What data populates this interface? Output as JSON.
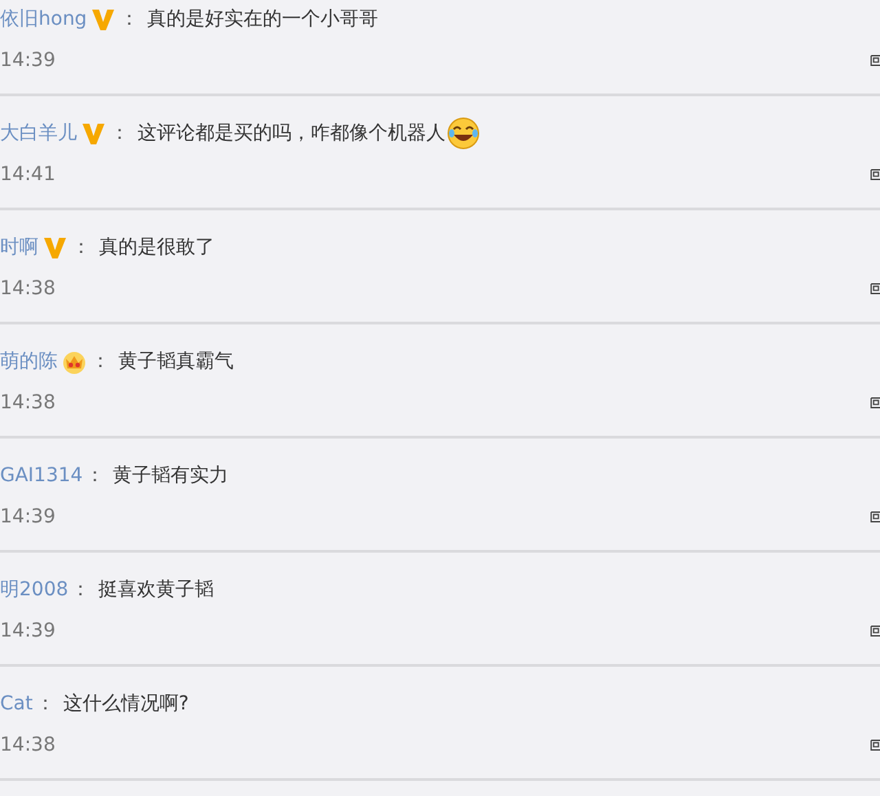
{
  "comments": [
    {
      "user": "依旧hong",
      "badge": {
        "kind": "vip"
      },
      "separator": "：",
      "text": "真的是好实在的一个小哥哥",
      "time": "14:39"
    },
    {
      "user": "大白羊儿",
      "badge": {
        "kind": "vip"
      },
      "separator": "：",
      "text": "这评论都是买的吗，咋都像个机器人",
      "emoji": {
        "kind": "laugh"
      },
      "time": "14:41"
    },
    {
      "user": "时啊",
      "badge": {
        "kind": "vip"
      },
      "separator": "：",
      "text": "真的是很敢了",
      "time": "14:38"
    },
    {
      "user": "萌的陈",
      "badge": {
        "kind": "crown"
      },
      "separator": "：",
      "text": "黄子韬真霸气",
      "time": "14:38"
    },
    {
      "user": "GAI1314",
      "separator": "：",
      "text": "黄子韬有实力",
      "time": "14:39"
    },
    {
      "user": "明2008",
      "separator": "：",
      "text": "挺喜欢黄子韬",
      "time": "14:39"
    },
    {
      "user": "Cat",
      "separator": "：",
      "text": "这什么情况啊?",
      "time": "14:38"
    }
  ]
}
